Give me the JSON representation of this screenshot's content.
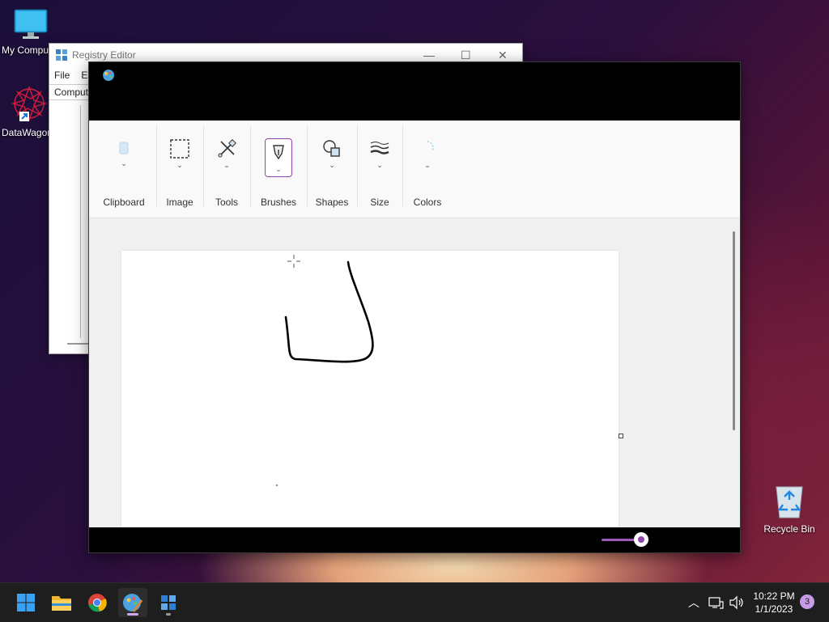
{
  "desktop": {
    "icons": [
      {
        "label": "My Computer"
      },
      {
        "label": "DataWagon"
      },
      {
        "label": "Recycle Bin"
      }
    ]
  },
  "registry_editor": {
    "title": "Registry Editor",
    "menu": [
      "File",
      "Edit"
    ],
    "address": "Computer",
    "controls": {
      "minimize": "—",
      "maximize": "☐",
      "close": "✕"
    }
  },
  "paint": {
    "ribbon": {
      "groups": [
        {
          "label": "Clipboard",
          "icon": "clipboard-icon"
        },
        {
          "label": "Image",
          "icon": "select-icon"
        },
        {
          "label": "Tools",
          "icon": "tools-icon"
        },
        {
          "label": "Brushes",
          "icon": "brush-icon"
        },
        {
          "label": "Shapes",
          "icon": "shapes-icon"
        },
        {
          "label": "Size",
          "icon": "size-icon"
        },
        {
          "label": "Colors",
          "icon": "colors-icon"
        }
      ]
    },
    "accent_color": "#8e44ad"
  },
  "taskbar": {
    "apps": [
      "start-icon",
      "file-explorer-icon",
      "chrome-icon",
      "paint-icon",
      "registry-editor-icon"
    ],
    "clock": {
      "time": "10:22 PM",
      "date": "1/1/2023"
    },
    "notification_count": "3"
  }
}
